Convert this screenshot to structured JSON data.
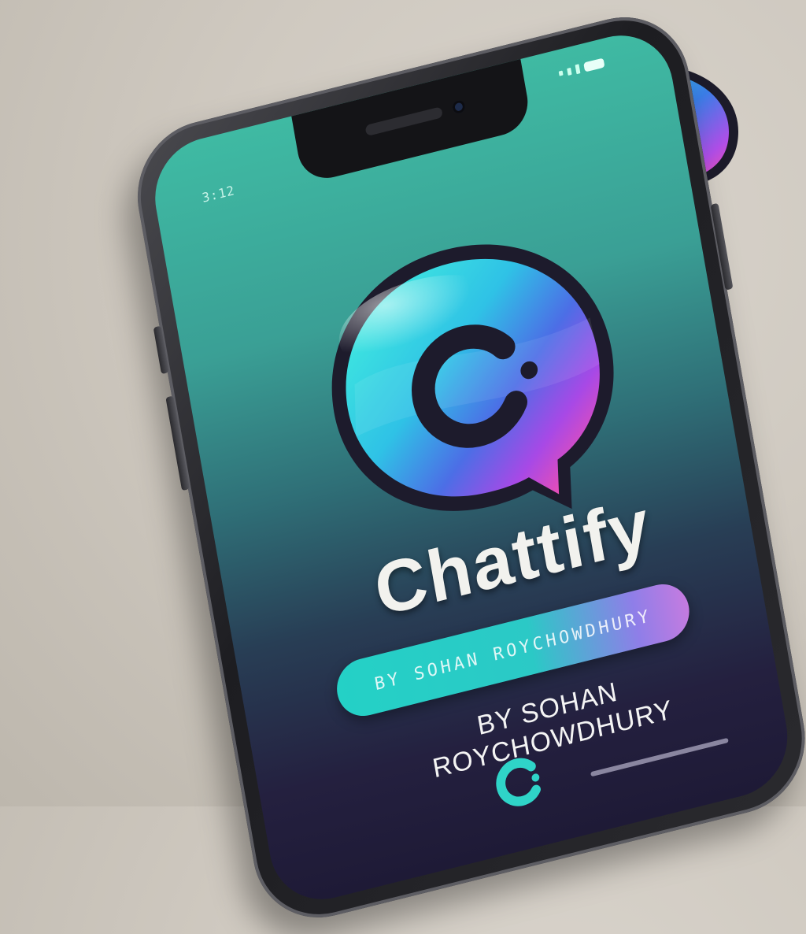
{
  "status_bar": {
    "time": "3:12",
    "battery": "battery-icon",
    "signal": "signal-icon"
  },
  "app": {
    "name": "Chattify",
    "byline_button_text": "BY SOHAN ROYCHOWDHURY",
    "byline": "BY SOHAN ROYCHOWDHURY"
  },
  "icons": {
    "main_logo": "chat-bubble-c-logo-icon",
    "app_icon": "chat-bubble-c-app-icon",
    "bottom_mark": "c-logo-icon"
  },
  "colors": {
    "teal": "#2bc9c6",
    "purple": "#8f55e8",
    "pink": "#f04fb0",
    "dark": "#241d3a"
  }
}
